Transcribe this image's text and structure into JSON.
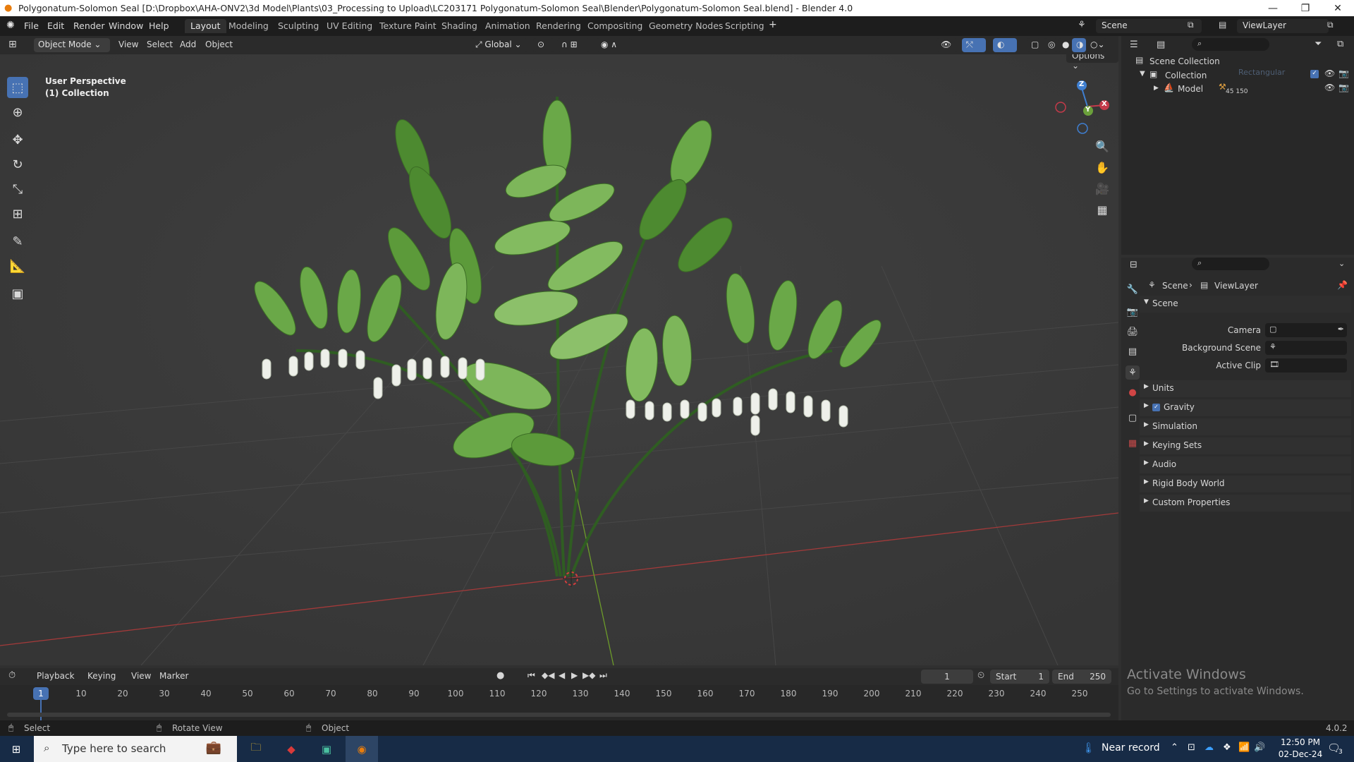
{
  "window": {
    "title": "Polygonatum-Solomon Seal [D:\\Dropbox\\AHA-ONV2\\3d Model\\Plants\\03_Processing to Upload\\LC203171 Polygonatum-Solomon Seal\\Blender\\Polygonatum-Solomon Seal.blend] - Blender 4.0"
  },
  "menu": [
    "File",
    "Edit",
    "Render",
    "Window",
    "Help"
  ],
  "workspaces": [
    "Layout",
    "Modeling",
    "Sculpting",
    "UV Editing",
    "Texture Paint",
    "Shading",
    "Animation",
    "Rendering",
    "Compositing",
    "Geometry Nodes",
    "Scripting"
  ],
  "scene_field": "Scene",
  "viewlayer_field": "ViewLayer",
  "viewport_header": {
    "mode": "Object Mode",
    "menus": [
      "View",
      "Select",
      "Add",
      "Object"
    ],
    "orientation": "Global",
    "options": "Options"
  },
  "viewport": {
    "perspective": "User Perspective",
    "collection": "(1) Collection",
    "gizmo": {
      "z": "Z",
      "y": "Y",
      "x": "X"
    }
  },
  "outliner": {
    "scene_collection": "Scene Collection",
    "collection": "Collection",
    "model": "Model",
    "model_extra": "45 150",
    "ghost": "Rectangular S..."
  },
  "properties": {
    "breadcrumb_scene": "Scene",
    "breadcrumb_viewlayer": "ViewLayer",
    "panel": "Scene",
    "camera_label": "Camera",
    "background_label": "Background Scene",
    "clip_label": "Active Clip",
    "sections": [
      "Units",
      "Gravity",
      "Simulation",
      "Keying Sets",
      "Audio",
      "Rigid Body World",
      "Custom Properties"
    ]
  },
  "timeline": {
    "menus": [
      "Playback",
      "Keying",
      "View",
      "Marker"
    ],
    "current_frame": "1",
    "start_label": "Start",
    "start": "1",
    "end_label": "End",
    "end": "250",
    "ticks": [
      "10",
      "20",
      "30",
      "40",
      "50",
      "60",
      "70",
      "80",
      "90",
      "100",
      "110",
      "120",
      "130",
      "140",
      "150",
      "160",
      "170",
      "180",
      "190",
      "200",
      "210",
      "220",
      "230",
      "240",
      "250"
    ],
    "playhead": "1"
  },
  "statusbar": {
    "select": "Select",
    "rotate": "Rotate View",
    "object": "Object",
    "version": "4.0.2"
  },
  "watermark": {
    "line1": "Activate Windows",
    "line2": "Go to Settings to activate Windows."
  },
  "taskbar": {
    "search": "Type here to search",
    "near_record": "Near record",
    "time": "12:50 PM",
    "date": "02-Dec-24",
    "notif": "3"
  }
}
